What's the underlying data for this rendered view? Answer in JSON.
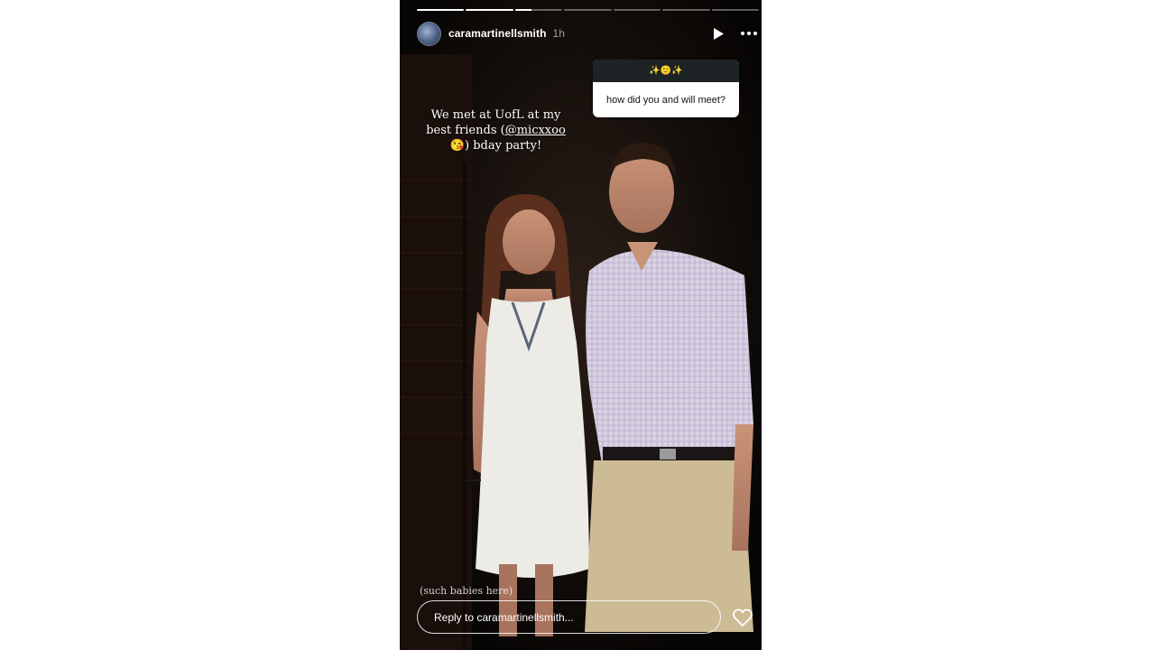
{
  "story": {
    "progress": [
      1,
      1,
      0.35,
      0,
      0,
      0,
      0
    ],
    "username": "caramartinellsmith",
    "time": "1h"
  },
  "question_sticker": {
    "header": "✨🙂✨",
    "question": "how did you and will meet?"
  },
  "caption": {
    "before": "We met at UofL at my best friends (",
    "mention": "@micxxoo",
    "after": " 😘) bday party!"
  },
  "footnote": "(such babies here)",
  "reply": {
    "placeholder": "Reply to caramartinellsmith..."
  },
  "icons": {
    "play": "play-icon",
    "more": "more-icon",
    "heart": "heart-icon",
    "avatar": "avatar"
  },
  "colors": {
    "story_bg": "#0b0806",
    "sticker_header_bg": "#1e2326"
  }
}
